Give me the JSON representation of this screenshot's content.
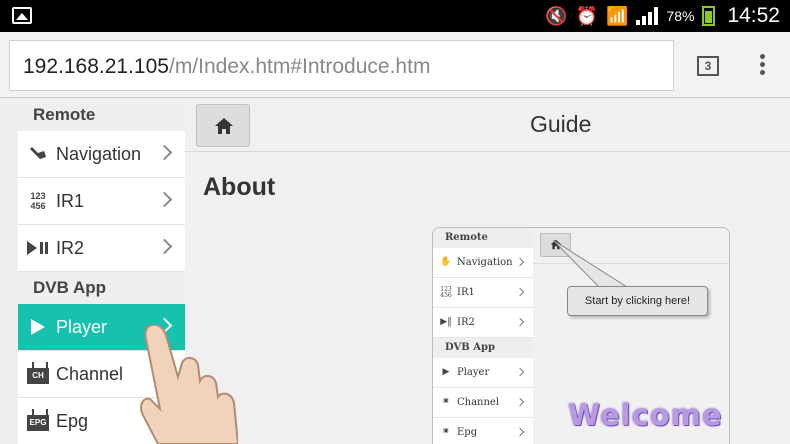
{
  "status_bar": {
    "battery": "78%",
    "time": "14:52"
  },
  "browser": {
    "url_host": "192.168.21.105",
    "url_path": "/m/Index.htm#Introduce.htm",
    "tab_count": "3"
  },
  "sidebar": {
    "sections": [
      {
        "title": "Remote",
        "items": [
          {
            "label": "Navigation",
            "icon": "hand-swipe-icon"
          },
          {
            "label": "IR1",
            "icon": "numpad-icon"
          },
          {
            "label": "IR2",
            "icon": "play-pause-icon"
          }
        ]
      },
      {
        "title": "DVB App",
        "items": [
          {
            "label": "Player",
            "icon": "play-icon",
            "active": true
          },
          {
            "label": "Channel",
            "icon": "ch-icon"
          },
          {
            "label": "Epg",
            "icon": "epg-icon"
          }
        ]
      }
    ]
  },
  "main": {
    "header_title": "Guide",
    "section_title": "About"
  },
  "guide_image": {
    "sections": [
      {
        "title": "Remote",
        "items": [
          "Navigation",
          "IR1",
          "IR2"
        ]
      },
      {
        "title": "DVB App",
        "items": [
          "Player",
          "Channel",
          "Epg"
        ]
      }
    ],
    "callout": "Start by clicking here!",
    "welcome": "Welcome"
  },
  "icons": {
    "ir1_icon_text": "123 456",
    "ch_icon_text": "CH",
    "epg_icon_text": "EPG"
  },
  "colors": {
    "active_item": "#16c2ad",
    "welcome": "#b69be3"
  }
}
